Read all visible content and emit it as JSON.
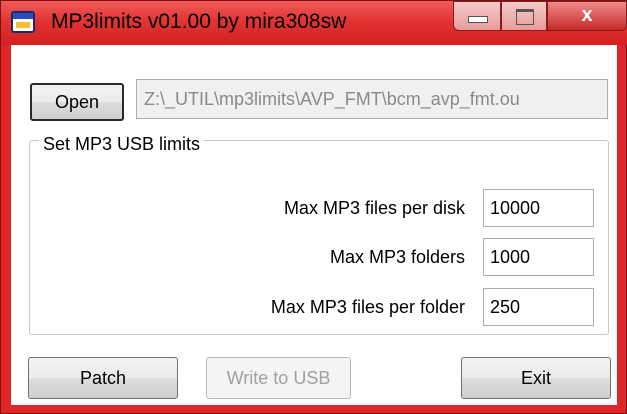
{
  "window": {
    "title": "MP3limits v01.00 by mira308sw",
    "close_glyph": "x",
    "icons": {
      "app": "app-window-icon",
      "minimize": "minimize-icon",
      "maximize": "maximize-icon",
      "close": "close-icon"
    },
    "accent_color": "#e02626"
  },
  "file": {
    "open_label": "Open",
    "path_value": "Z:\\_UTIL\\mp3limits\\AVP_FMT\\bcm_avp_fmt.ou"
  },
  "limits": {
    "group_label": "Set MP3 USB limits",
    "rows": [
      {
        "label": "Max MP3 files per disk",
        "value": "10000"
      },
      {
        "label": "Max MP3 folders",
        "value": "1000"
      },
      {
        "label": "Max MP3 files per folder",
        "value": "250"
      }
    ]
  },
  "actions": {
    "patch_label": "Patch",
    "write_label": "Write to USB",
    "exit_label": "Exit"
  }
}
